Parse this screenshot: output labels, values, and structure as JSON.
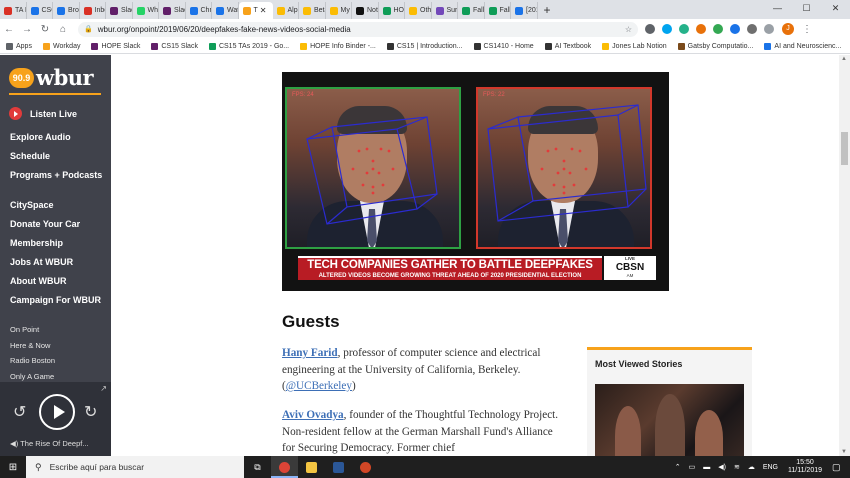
{
  "browser": {
    "tabs": [
      {
        "label": "TA H",
        "color": "#d93025"
      },
      {
        "label": "CSC",
        "color": "#1a73e8"
      },
      {
        "label": "Brow",
        "color": "#1a73e8"
      },
      {
        "label": "Inbo",
        "color": "#d93025"
      },
      {
        "label": "Slac",
        "color": "#611f69"
      },
      {
        "label": "Wh",
        "color": "#25d366"
      },
      {
        "label": "Slac",
        "color": "#611f69"
      },
      {
        "label": "Chri",
        "color": "#1a73e8"
      },
      {
        "label": "Wat",
        "color": "#1a73e8"
      },
      {
        "label": "T",
        "color": "#f7a21b",
        "active": true
      },
      {
        "label": "Alph",
        "color": "#fbbc04"
      },
      {
        "label": "Beta",
        "color": "#fbbc04"
      },
      {
        "label": "My",
        "color": "#fbbc04"
      },
      {
        "label": "Noti",
        "color": "#111111"
      },
      {
        "label": "HOF",
        "color": "#0f9d58"
      },
      {
        "label": "Oth",
        "color": "#fbbc04"
      },
      {
        "label": "Surv",
        "color": "#7248b9"
      },
      {
        "label": "Fall",
        "color": "#0f9d58"
      },
      {
        "label": "Fall",
        "color": "#0f9d58"
      },
      {
        "label": "[201",
        "color": "#1a73e8"
      }
    ],
    "tab_close": "✕",
    "new_tab": "+",
    "window_controls": {
      "minimize": "—",
      "maximize": "☐",
      "close": "✕"
    },
    "url": "wbur.org/onpoint/2019/06/20/deepfakes-fake-news-videos-social-media",
    "bookmarks": [
      {
        "label": "Apps",
        "color": "#5f6368"
      },
      {
        "label": "Workday",
        "color": "#f7a21b"
      },
      {
        "label": "HOPE Slack",
        "color": "#611f69"
      },
      {
        "label": "CS15 Slack",
        "color": "#611f69"
      },
      {
        "label": "CS15 TAs 2019 - Go...",
        "color": "#0f9d58"
      },
      {
        "label": "HOPE Info Binder -...",
        "color": "#fbbc04"
      },
      {
        "label": "CS15 | Introduction...",
        "color": "#333333"
      },
      {
        "label": "CS1410 - Home",
        "color": "#333333"
      },
      {
        "label": "AI Textbook",
        "color": "#333333"
      },
      {
        "label": "Jones Lab Notion",
        "color": "#fbbc04"
      },
      {
        "label": "Gatsby Computatio...",
        "color": "#7a4a1a"
      },
      {
        "label": "AI and Neuroscienc...",
        "color": "#1a73e8"
      }
    ],
    "bookmarks_more": "»",
    "profile_initial": "J"
  },
  "sidebar": {
    "logo_badge": "90.9",
    "logo_text": "wbur",
    "listen_live": "Listen Live",
    "primary_nav": [
      "Explore Audio",
      "Schedule",
      "Programs + Podcasts"
    ],
    "secondary_nav": [
      "CitySpace",
      "Donate Your Car",
      "Membership",
      "Jobs At WBUR",
      "About WBUR",
      "Campaign For WBUR"
    ],
    "tertiary_nav": [
      "On Point",
      "Here & Now",
      "Radio Boston",
      "Only A Game"
    ],
    "now_playing": "The Rise Of Deepf..."
  },
  "video": {
    "fps_left": "FPS: 24",
    "fps_right": "FPS: 22",
    "headline": "TECH COMPANIES GATHER TO BATTLE DEEPFAKES",
    "subheadline": "ALTERED VIDEOS BECOME GROWING THREAT AHEAD OF 2020 PRESIDENTIAL ELECTION",
    "network_live": "LIVE",
    "network": "CBSN",
    "network_sub": "AM"
  },
  "article": {
    "guests_heading": "Guests",
    "guest1": {
      "name": "Hany Farid",
      "desc": ", professor of computer science and electrical engineering at the University of California, Berkeley. (",
      "handle": "@UCBerkeley",
      "close": ")"
    },
    "guest2": {
      "name": "Aviv Ovadya",
      "desc": ", founder of the Thoughtful Technology Project. Non-resident fellow at the German Marshall Fund's Alliance for Securing Democracy. Former chief"
    }
  },
  "most_viewed": {
    "title": "Most Viewed Stories"
  },
  "taskbar": {
    "search_placeholder": "Escribe aquí para buscar",
    "language": "ENG",
    "time": "15:50",
    "date": "11/11/2019"
  }
}
